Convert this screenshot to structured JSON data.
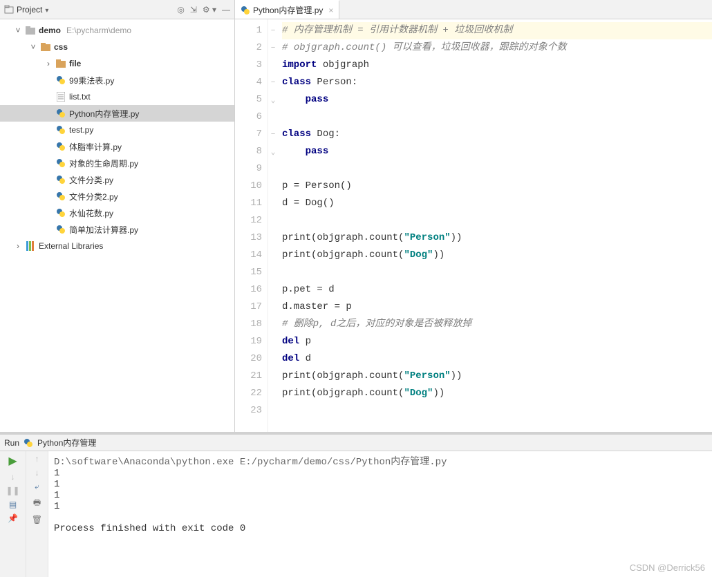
{
  "project": {
    "title": "Project",
    "root": {
      "label": "demo",
      "path": "E:\\pycharm\\demo"
    },
    "css": {
      "label": "css"
    },
    "file_folder": {
      "label": "file"
    },
    "files": [
      "99乘法表.py",
      "list.txt",
      "Python内存管理.py",
      "test.py",
      "体脂率计算.py",
      "对象的生命周期.py",
      "文件分类.py",
      "文件分类2.py",
      "水仙花数.py",
      "简单加法计算器.py"
    ],
    "external": "External Libraries"
  },
  "tab": {
    "name": "Python内存管理.py"
  },
  "code": {
    "lines": [
      {
        "n": 1,
        "hl": true,
        "html": "<span class='cm'># 内存管理机制 = 引用计数器机制 + 垃圾回收机制</span>"
      },
      {
        "n": 2,
        "html": "<span class='cm'># <i>objgraph.count()</i> 可以查看，垃圾回收器，跟踪的对象个数</span>"
      },
      {
        "n": 3,
        "html": "<span class='k'>import </span>objgraph"
      },
      {
        "n": 4,
        "html": "<span class='k'>class </span>Person:"
      },
      {
        "n": 5,
        "html": "    <span class='k'>pass</span>"
      },
      {
        "n": 6,
        "html": ""
      },
      {
        "n": 7,
        "html": "<span class='k'>class </span>Dog:"
      },
      {
        "n": 8,
        "html": "    <span class='k'>pass</span>"
      },
      {
        "n": 9,
        "html": ""
      },
      {
        "n": 10,
        "html": "p = Person()"
      },
      {
        "n": 11,
        "html": "d = Dog()"
      },
      {
        "n": 12,
        "html": ""
      },
      {
        "n": 13,
        "html": "print(objgraph.count(<span class='s'>\"Person\"</span>))"
      },
      {
        "n": 14,
        "html": "print(objgraph.count(<span class='s'>\"Dog\"</span>))"
      },
      {
        "n": 15,
        "html": ""
      },
      {
        "n": 16,
        "html": "p.pet = d"
      },
      {
        "n": 17,
        "html": "d.master = p"
      },
      {
        "n": 18,
        "html": "<span class='cm'># 删除p, d之后，对应的对象是否被释放掉</span>"
      },
      {
        "n": 19,
        "html": "<span class='k'>del </span>p"
      },
      {
        "n": 20,
        "html": "<span class='k'>del </span>d"
      },
      {
        "n": 21,
        "html": "print(objgraph.count(<span class='s'>\"Person\"</span>))"
      },
      {
        "n": 22,
        "html": "print(objgraph.count(<span class='s'>\"Dog\"</span>))"
      },
      {
        "n": 23,
        "html": ""
      }
    ],
    "folds": {
      "1": "−",
      "2": "−",
      "4": "−",
      "5": "⌄",
      "7": "−",
      "8": "⌄"
    }
  },
  "run": {
    "tab_label": "Run",
    "config_name": "Python内存管理",
    "cmd": "D:\\software\\Anaconda\\python.exe E:/pycharm/demo/css/Python内存管理.py",
    "output": [
      "1",
      "1",
      "1",
      "1"
    ],
    "exit": "Process finished with exit code 0"
  },
  "watermark": "CSDN @Derrick56"
}
